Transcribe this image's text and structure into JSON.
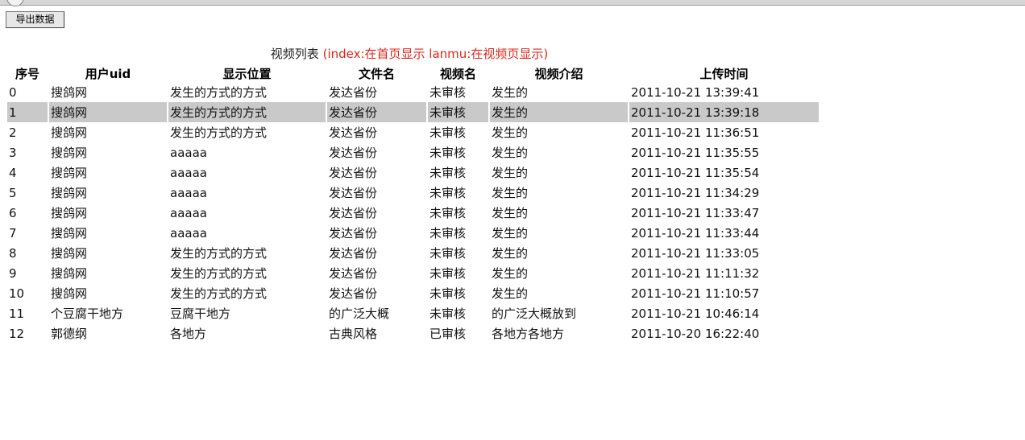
{
  "toolbar": {
    "export_label": "导出数据"
  },
  "caption": {
    "title": "视频列表",
    "note": "(index:在首页显示 lanmu:在视频页显示)",
    "note_color": "#e1251b"
  },
  "table": {
    "headers": [
      "序号",
      "用户uid",
      "显示位置",
      "文件名",
      "视频名",
      "视频介绍",
      "上传时间"
    ],
    "selected_row": 1,
    "selected_color": "#c9c9c9",
    "rows": [
      [
        "0",
        "搜鸽网",
        "发生的方式的方式",
        "发达省份",
        "未审核",
        "发生的",
        "2011-10-21 13:39:41"
      ],
      [
        "1",
        "搜鸽网",
        "发生的方式的方式",
        "发达省份",
        "未审核",
        "发生的",
        "2011-10-21 13:39:18"
      ],
      [
        "2",
        "搜鸽网",
        "发生的方式的方式",
        "发达省份",
        "未审核",
        "发生的",
        "2011-10-21 11:36:51"
      ],
      [
        "3",
        "搜鸽网",
        "aaaaa",
        "发达省份",
        "未审核",
        "发生的",
        "2011-10-21 11:35:55"
      ],
      [
        "4",
        "搜鸽网",
        "aaaaa",
        "发达省份",
        "未审核",
        "发生的",
        "2011-10-21 11:35:54"
      ],
      [
        "5",
        "搜鸽网",
        "aaaaa",
        "发达省份",
        "未审核",
        "发生的",
        "2011-10-21 11:34:29"
      ],
      [
        "6",
        "搜鸽网",
        "aaaaa",
        "发达省份",
        "未审核",
        "发生的",
        "2011-10-21 11:33:47"
      ],
      [
        "7",
        "搜鸽网",
        "aaaaa",
        "发达省份",
        "未审核",
        "发生的",
        "2011-10-21 11:33:44"
      ],
      [
        "8",
        "搜鸽网",
        "发生的方式的方式",
        "发达省份",
        "未审核",
        "发生的",
        "2011-10-21 11:33:05"
      ],
      [
        "9",
        "搜鸽网",
        "发生的方式的方式",
        "发达省份",
        "未审核",
        "发生的",
        "2011-10-21 11:11:32"
      ],
      [
        "10",
        "搜鸽网",
        "发生的方式的方式",
        "发达省份",
        "未审核",
        "发生的",
        "2011-10-21 11:10:57"
      ],
      [
        "11",
        "个豆腐干地方",
        "豆腐干地方",
        "的广泛大概",
        "未审核",
        "的广泛大概放到",
        "2011-10-21 10:46:14"
      ],
      [
        "12",
        "郭德纲",
        "各地方",
        "古典风格",
        "已审核",
        " 各地方各地方",
        "2011-10-20 16:22:40"
      ]
    ]
  }
}
